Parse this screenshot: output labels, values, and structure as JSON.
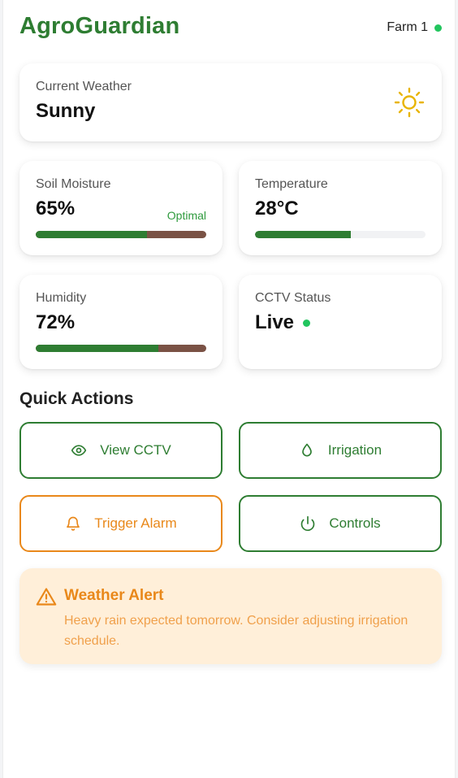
{
  "header": {
    "brand": "AgroGuardian",
    "farm_label": "Farm 1",
    "status_color": "#22c55e"
  },
  "weather": {
    "label": "Current Weather",
    "value": "Sunny",
    "icon": "sun-icon"
  },
  "stats": {
    "soil": {
      "label": "Soil Moisture",
      "value": "65%",
      "status": "Optimal",
      "level": 0.65
    },
    "temperature": {
      "label": "Temperature",
      "value": "28°C",
      "level": 0.56
    },
    "humidity": {
      "label": "Humidity",
      "value": "72%",
      "level": 0.72
    },
    "cctv": {
      "label": "CCTV Status",
      "value": "Live"
    }
  },
  "quick_actions": {
    "title": "Quick Actions",
    "view_cctv": {
      "label": "View CCTV",
      "icon": "eye-icon"
    },
    "irrigation": {
      "label": "Irrigation",
      "icon": "droplet-icon"
    },
    "trigger_alarm": {
      "label": "Trigger Alarm",
      "icon": "bell-icon"
    },
    "controls": {
      "label": "Controls",
      "icon": "power-icon"
    }
  },
  "alert": {
    "title": "Weather Alert",
    "message": "Heavy rain expected tomorrow. Consider adjusting irrigation schedule.",
    "icon": "warning-icon"
  },
  "colors": {
    "primary": "#2e7d32",
    "soil_brown": "#7a5245",
    "warning": "#e9881a",
    "alert_bg": "#ffefd9"
  }
}
